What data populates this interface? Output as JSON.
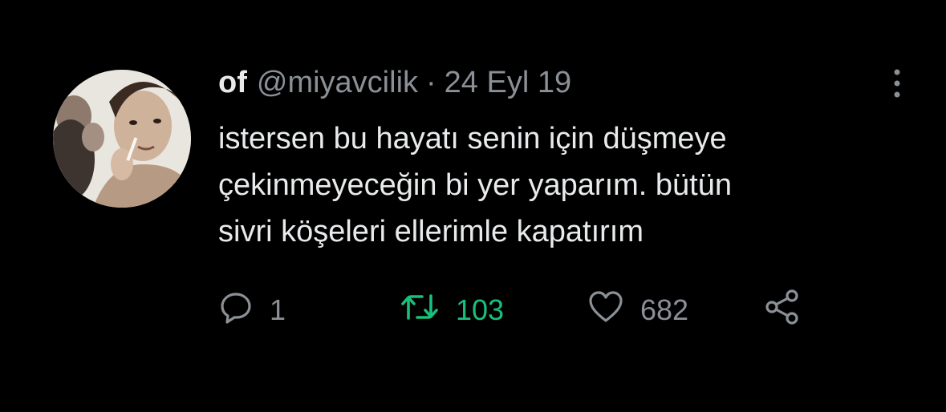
{
  "tweet": {
    "display_name": "of",
    "handle": "@miyavcilik",
    "separator": "·",
    "date": "24 Eyl 19",
    "text": "istersen bu hayatı senin için düşmeye\nçekinmeyeceğin bi yer yaparım. bütün\nsivri köşeleri ellerimle kapatırım",
    "avatar_icon": "profile-photo",
    "more_icon": "more-vertical-icon"
  },
  "actions": {
    "reply_count": "1",
    "retweet_count": "103",
    "like_count": "682",
    "retweet_active_color": "#19c07b",
    "icons": [
      "reply-icon",
      "retweet-icon",
      "like-icon",
      "share-icon"
    ]
  }
}
